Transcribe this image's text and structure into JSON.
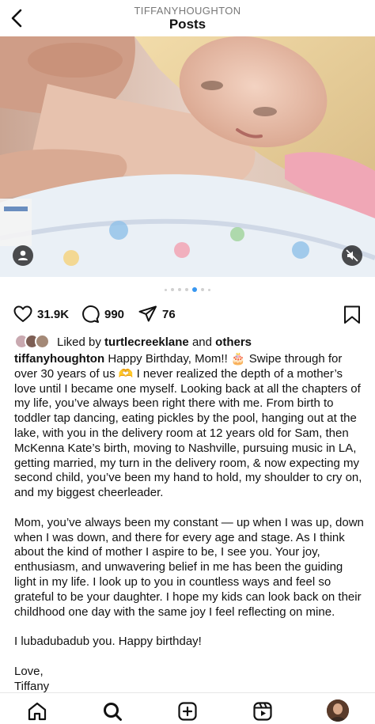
{
  "header": {
    "username": "TIFFANYHOUGHTON",
    "title": "Posts"
  },
  "post": {
    "carousel": {
      "count": 7,
      "active_index": 4
    },
    "likes": "31.9K",
    "comments": "990",
    "shares": "76",
    "liked_by": {
      "prefix": "Liked by",
      "user": "turtlecreeklane",
      "conj": "and",
      "others": "others"
    },
    "caption": {
      "username": "tiffanyhoughton",
      "p1": "Happy Birthday, Mom!! 🎂 Swipe through for over 30 years of us 🫶 I never realized the depth of a mother’s love until I became one myself. Looking back at all the chapters of my life, you’ve always been right there with me. From birth to toddler tap dancing, eating pickles by the pool, hanging out at the lake, with you in the delivery room at 12 years old for Sam, then McKenna Kate’s birth, moving to Nashville, pursuing music in LA, getting married, my turn in the delivery room, & now expecting my second child, you’ve been my hand to hold, my shoulder to cry on, and my biggest cheerleader.",
      "p2": "Mom, you’ve always been my constant — up when I was up, down when I was down, and there for every age and stage. As I think about the kind of mother I aspire to be, I see you. Your joy, enthusiasm, and unwavering belief in me has been the guiding light in my life. I look up to you in countless ways and feel so grateful to be your daughter. I hope my kids can look back on their childhood one day with the same joy I feel reflecting on mine.",
      "p3": "I lubadubadub you. Happy birthday!",
      "p4": "Love,\nTiffany"
    }
  },
  "colors": {
    "accent": "#3897f0",
    "text": "#111111",
    "muted": "#777777"
  },
  "nav": [
    "home-icon",
    "search-icon",
    "create-icon",
    "reels-icon",
    "profile-avatar"
  ]
}
